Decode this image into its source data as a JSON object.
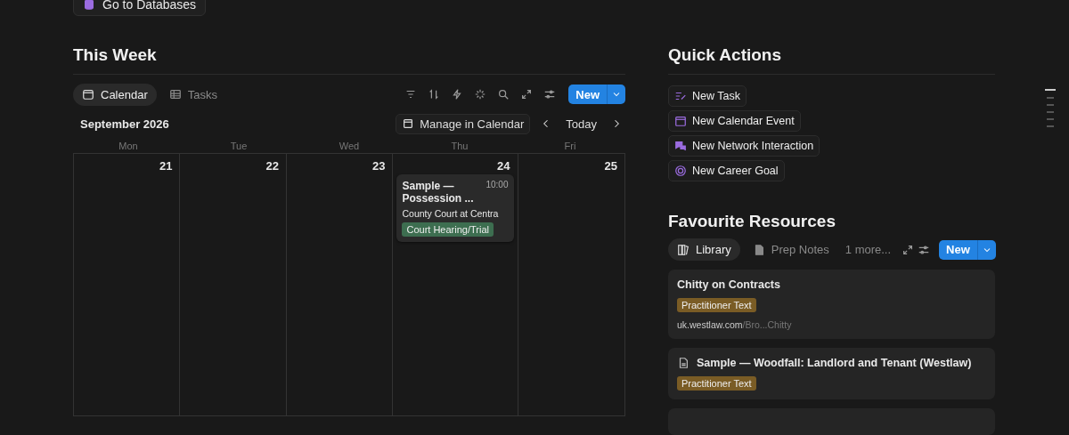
{
  "top_button": {
    "label": "Go to Databases"
  },
  "this_week": {
    "title": "This Week",
    "views": [
      {
        "label": "Calendar",
        "kind": "calendar",
        "selected": true
      },
      {
        "label": "Tasks",
        "kind": "table",
        "selected": false
      }
    ],
    "new_button": "New",
    "month": "September 2026",
    "manage_button": "Manage in Calendar",
    "today_button": "Today",
    "weekdays": [
      "Mon",
      "Tue",
      "Wed",
      "Thu",
      "Fri"
    ],
    "days": [
      {
        "date": "21"
      },
      {
        "date": "22"
      },
      {
        "date": "23"
      },
      {
        "date": "24",
        "events": [
          {
            "title": "Sample — Possession ...",
            "time": "10:00",
            "location": "County Court at Centra",
            "tag": "Court Hearing/Trial",
            "color": "#3d6e50"
          }
        ]
      },
      {
        "date": "25"
      }
    ]
  },
  "quick_actions": {
    "title": "Quick Actions",
    "items": [
      {
        "label": "New Task",
        "kind": "task"
      },
      {
        "label": "New Calendar Event",
        "kind": "calendar"
      },
      {
        "label": "New Network Interaction",
        "kind": "chat"
      },
      {
        "label": "New Career Goal",
        "kind": "goal"
      }
    ]
  },
  "resources": {
    "title": "Favourite Resources",
    "views": [
      {
        "label": "Library",
        "kind": "library",
        "selected": true
      },
      {
        "label": "Prep Notes",
        "kind": "page",
        "selected": false
      }
    ],
    "more": "1 more...",
    "new_button": "New",
    "cards": [
      {
        "title": "Chitty on Contracts",
        "has_icon": false,
        "tag": "Practitioner Text",
        "color": "#7a5c25",
        "url_host": "uk.westlaw.com",
        "url_path": "/Bro...Chitty"
      },
      {
        "title": "Sample — Woodfall: Landlord and Tenant (Westlaw)",
        "has_icon": true,
        "tag": "Practitioner Text",
        "color": "#7a5c25"
      }
    ]
  }
}
